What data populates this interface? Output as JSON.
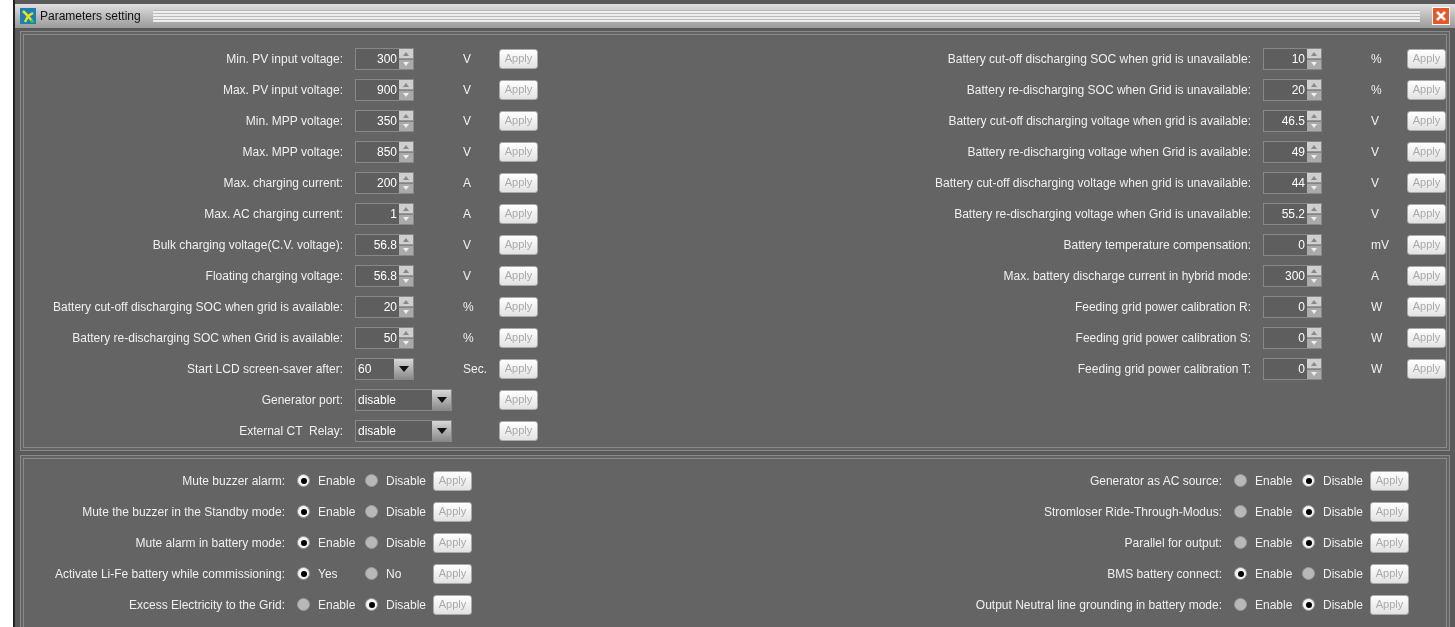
{
  "window": {
    "title": "Parameters setting"
  },
  "left_settings": [
    {
      "kind": "spinner",
      "label": "Min. PV input voltage:",
      "value": "300",
      "unit": "V",
      "apply": "Apply",
      "apply_disabled": true
    },
    {
      "kind": "spinner",
      "label": "Max. PV input voltage:",
      "value": "900",
      "unit": "V",
      "apply": "Apply",
      "apply_disabled": true
    },
    {
      "kind": "spinner",
      "label": "Min. MPP voltage:",
      "value": "350",
      "unit": "V",
      "apply": "Apply",
      "apply_disabled": true
    },
    {
      "kind": "spinner",
      "label": "Max. MPP voltage:",
      "value": "850",
      "unit": "V",
      "apply": "Apply",
      "apply_disabled": true
    },
    {
      "kind": "spinner",
      "label": "Max. charging current:",
      "value": "200",
      "unit": "A",
      "apply": "Apply",
      "apply_disabled": true
    },
    {
      "kind": "spinner",
      "label": "Max. AC charging current:",
      "value": "1",
      "unit": "A",
      "apply": "Apply",
      "apply_disabled": true
    },
    {
      "kind": "spinner",
      "label": "Bulk charging voltage(C.V. voltage):",
      "value": "56.8",
      "unit": "V",
      "apply": "Apply",
      "apply_disabled": true
    },
    {
      "kind": "spinner",
      "label": "Floating charging voltage:",
      "value": "56.8",
      "unit": "V",
      "apply": "Apply",
      "apply_disabled": true
    },
    {
      "kind": "spinner",
      "label": "Battery cut-off discharging SOC when grid is available:",
      "value": "20",
      "unit": "%",
      "apply": "Apply",
      "apply_disabled": true
    },
    {
      "kind": "spinner",
      "label": "Battery re-discharging SOC when Grid is available:",
      "value": "50",
      "unit": "%",
      "apply": "Apply",
      "apply_disabled": true
    },
    {
      "kind": "combo",
      "label": "Start LCD screen-saver after:",
      "value": "60",
      "unit": "Sec.",
      "apply": "Apply",
      "apply_disabled": true
    },
    {
      "kind": "dropdown",
      "label": "Generator port:",
      "value": "disable",
      "apply": "Apply",
      "apply_disabled": true
    },
    {
      "kind": "dropdown",
      "label": "External CT  Relay:",
      "value": "disable",
      "apply": "Apply",
      "apply_disabled": true
    }
  ],
  "right_settings": [
    {
      "kind": "spinner",
      "label": "Battery cut-off discharging SOC when grid is unavailable:",
      "value": "10",
      "unit": "%",
      "apply": "Apply",
      "apply_disabled": true
    },
    {
      "kind": "spinner",
      "label": "Battery re-discharging SOC when Grid is unavailable:",
      "value": "20",
      "unit": "%",
      "apply": "Apply",
      "apply_disabled": true
    },
    {
      "kind": "spinner",
      "label": "Battery cut-off discharging voltage when grid is available:",
      "value": "46.5",
      "unit": "V",
      "apply": "Apply",
      "apply_disabled": true
    },
    {
      "kind": "spinner",
      "label": "Battery re-discharging voltage when Grid is available:",
      "value": "49",
      "unit": "V",
      "apply": "Apply",
      "apply_disabled": true
    },
    {
      "kind": "spinner",
      "label": "Battery cut-off discharging voltage when grid is unavailable:",
      "value": "44",
      "unit": "V",
      "apply": "Apply",
      "apply_disabled": true
    },
    {
      "kind": "spinner",
      "label": "Battery re-discharging voltage when Grid is unavailable:",
      "value": "55.2",
      "unit": "V",
      "apply": "Apply",
      "apply_disabled": true
    },
    {
      "kind": "spinner",
      "label": "Battery temperature compensation:",
      "value": "0",
      "unit": "mV",
      "apply": "Apply",
      "apply_disabled": true
    },
    {
      "kind": "spinner",
      "label": "Max. battery discharge current in hybrid mode:",
      "value": "300",
      "unit": "A",
      "apply": "Apply",
      "apply_disabled": true
    },
    {
      "kind": "spinner",
      "label": "Feeding grid power calibration R:",
      "value": "0",
      "unit": "W",
      "apply": "Apply",
      "apply_disabled": true
    },
    {
      "kind": "spinner",
      "label": "Feeding grid power calibration S:",
      "value": "0",
      "unit": "W",
      "apply": "Apply",
      "apply_disabled": true
    },
    {
      "kind": "spinner",
      "label": "Feeding grid power calibration T:",
      "value": "0",
      "unit": "W",
      "apply": "Apply",
      "apply_disabled": true
    }
  ],
  "left_toggles": [
    {
      "label": "Mute buzzer alarm:",
      "options": [
        {
          "label": "Enable",
          "selected": true
        },
        {
          "label": "Disable",
          "selected": false
        }
      ],
      "apply": "Apply",
      "apply_disabled": true
    },
    {
      "label": "Mute the buzzer in the Standby mode:",
      "options": [
        {
          "label": "Enable",
          "selected": true
        },
        {
          "label": "Disable",
          "selected": false
        }
      ],
      "apply": "Apply",
      "apply_disabled": true
    },
    {
      "label": "Mute alarm in battery mode:",
      "options": [
        {
          "label": "Enable",
          "selected": true
        },
        {
          "label": "Disable",
          "selected": false
        }
      ],
      "apply": "Apply",
      "apply_disabled": true
    },
    {
      "label": "Activate Li-Fe battery while commissioning:",
      "options": [
        {
          "label": "Yes",
          "selected": true
        },
        {
          "label": "No",
          "selected": false
        }
      ],
      "apply": "Apply",
      "apply_disabled": true
    },
    {
      "label": "Excess Electricity to the Grid:",
      "options": [
        {
          "label": "Enable",
          "selected": false
        },
        {
          "label": "Disable",
          "selected": true
        }
      ],
      "apply": "Apply",
      "apply_disabled": true
    }
  ],
  "right_toggles": [
    {
      "label": "Generator as AC source:",
      "options": [
        {
          "label": "Enable",
          "selected": false
        },
        {
          "label": "Disable",
          "selected": true
        }
      ],
      "apply": "Apply",
      "apply_disabled": true
    },
    {
      "label": "Stromloser Ride-Through-Modus:",
      "options": [
        {
          "label": "Enable",
          "selected": false
        },
        {
          "label": "Disable",
          "selected": true
        }
      ],
      "apply": "Apply",
      "apply_disabled": true
    },
    {
      "label": "Parallel for output:",
      "options": [
        {
          "label": "Enable",
          "selected": false
        },
        {
          "label": "Disable",
          "selected": true
        }
      ],
      "apply": "Apply",
      "apply_disabled": true
    },
    {
      "label": "BMS battery connect:",
      "options": [
        {
          "label": "Enable",
          "selected": true
        },
        {
          "label": "Disable",
          "selected": false
        }
      ],
      "apply": "Apply",
      "apply_disabled": true
    },
    {
      "label": "Output Neutral line grounding in battery mode:",
      "options": [
        {
          "label": "Enable",
          "selected": false
        },
        {
          "label": "Disable",
          "selected": true
        }
      ],
      "apply": "Apply",
      "apply_disabled": true
    }
  ]
}
